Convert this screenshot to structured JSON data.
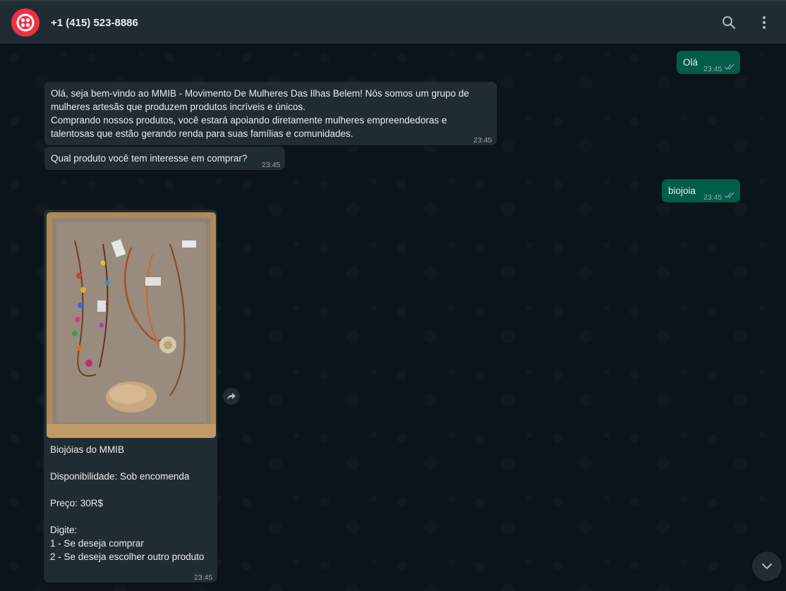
{
  "header": {
    "contact_name": "+1 (415) 523-8886",
    "avatar_color": "#f22f46",
    "icons": [
      "search-icon",
      "menu-icon"
    ]
  },
  "colors": {
    "incoming_bubble": "#202c33",
    "outgoing_bubble": "#005c4b",
    "background": "#0b141a",
    "read_ticks": "#8696a0"
  },
  "messages": [
    {
      "direction": "out",
      "text": "Olá",
      "time": "23:45",
      "status": "read"
    },
    {
      "direction": "in",
      "text": "Olá, seja bem-vindo ao MMIB - Movimento De Mulheres Das Ilhas Belem! Nós somos um grupo de\nmulheres artesãs que produzem produtos incríveis e únicos.\nComprando nossos produtos, você estará apoiando diretamente mulheres empreendedoras e\ntalentosas que estão gerando renda para suas famílias e comunidades.",
      "time": "23:45"
    },
    {
      "direction": "in",
      "text": "Qual produto você tem interesse em comprar?",
      "time": "23:45"
    },
    {
      "direction": "out",
      "text": "biojoia",
      "time": "23:45",
      "status": "read"
    },
    {
      "direction": "in",
      "type": "image",
      "caption": "Biojóias do MMIB\n\nDisponibilidade: Sob encomenda\n\nPreço: 30R$\n\nDigite:\n1 - Se deseja comprar\n2 - Se deseja escolher outro produto",
      "time": "23:45"
    }
  ]
}
